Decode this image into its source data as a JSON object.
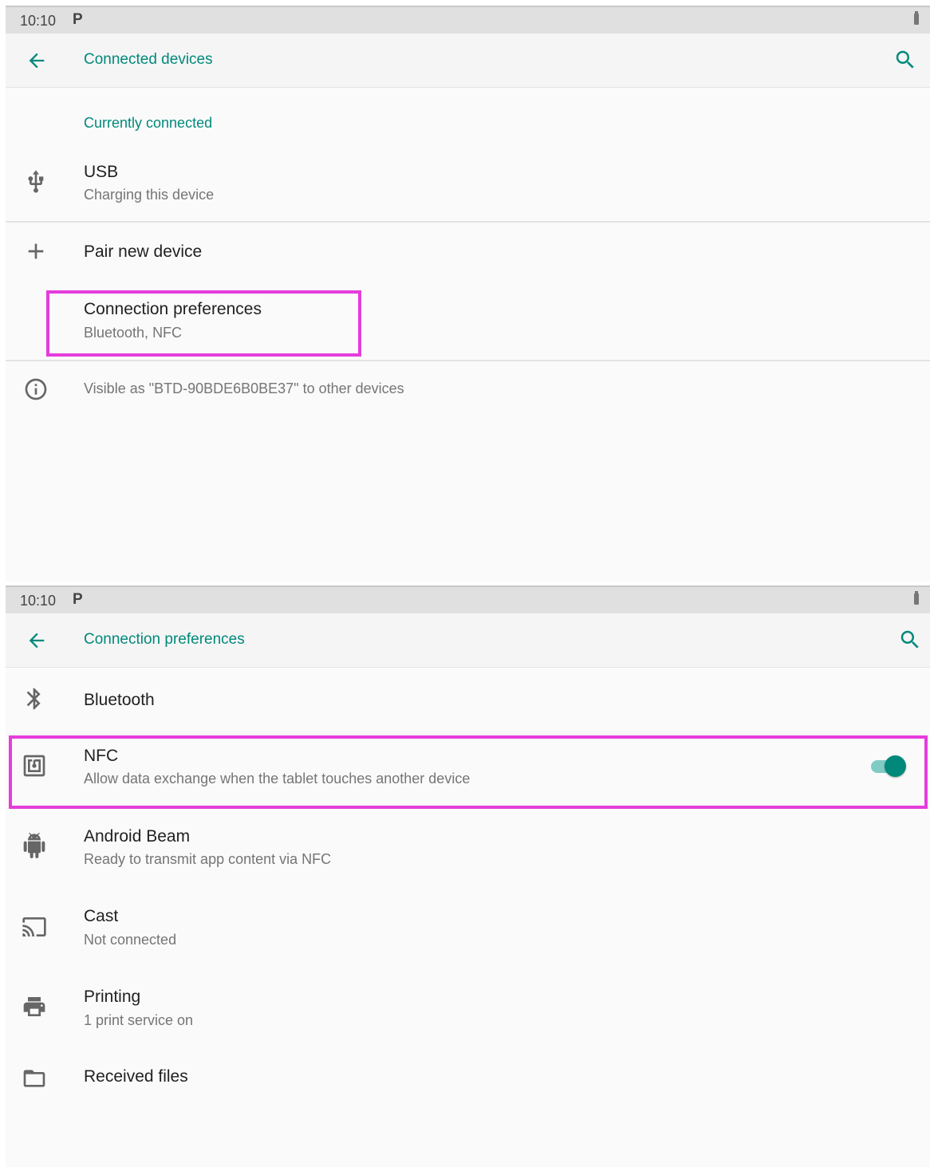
{
  "screen1": {
    "status": {
      "time": "10:10",
      "notification_icon": "P"
    },
    "toolbar": {
      "title": "Connected devices",
      "back_icon": "arrow-back-icon",
      "search_icon": "search-icon"
    },
    "section_header": "Currently connected",
    "usb": {
      "title": "USB",
      "summary": "Charging this device",
      "icon": "usb-icon"
    },
    "pair": {
      "title": "Pair new device",
      "icon": "plus-icon"
    },
    "connection_prefs": {
      "title": "Connection preferences",
      "summary": "Bluetooth, NFC"
    },
    "visible_as": {
      "text": "Visible as \"BTD-90BDE6B0BE37\" to other devices",
      "icon": "info-icon"
    }
  },
  "screen2": {
    "status": {
      "time": "10:10",
      "notification_icon": "P"
    },
    "toolbar": {
      "title": "Connection preferences",
      "back_icon": "arrow-back-icon",
      "search_icon": "search-icon"
    },
    "bluetooth": {
      "title": "Bluetooth",
      "icon": "bluetooth-icon"
    },
    "nfc": {
      "title": "NFC",
      "summary": "Allow data exchange when the tablet touches another device",
      "icon": "nfc-icon",
      "enabled": true
    },
    "android_beam": {
      "title": "Android Beam",
      "summary": "Ready to transmit app content via NFC",
      "icon": "android-icon"
    },
    "cast": {
      "title": "Cast",
      "summary": "Not connected",
      "icon": "cast-icon"
    },
    "printing": {
      "title": "Printing",
      "summary": "1 print service on",
      "icon": "printer-icon"
    },
    "received_files": {
      "title": "Received files",
      "icon": "folder-icon"
    }
  },
  "colors": {
    "accent": "#00897b",
    "highlight": "#e53ddb",
    "toggle_track": "#80cbc4"
  }
}
